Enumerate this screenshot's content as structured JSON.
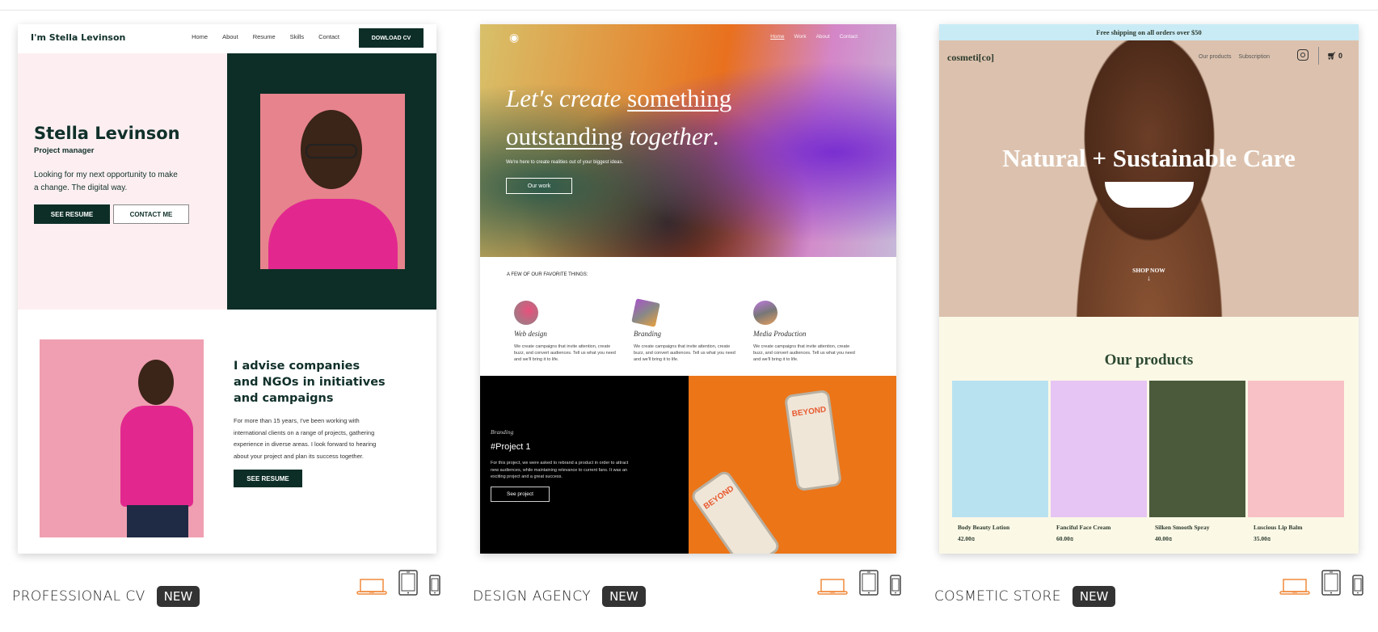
{
  "templates": [
    {
      "name": "PROFESSIONAL CV",
      "badge": "NEW",
      "preview": {
        "nav": {
          "logo": "I'm Stella Levinson",
          "links": [
            "Home",
            "About",
            "Resume",
            "Skills",
            "Contact"
          ],
          "cta": "DOWLOAD CV"
        },
        "hero": {
          "name": "Stella Levinson",
          "role": "Project manager",
          "tagline": "Looking for my next opportunity to make a change. The digital way.",
          "primary_button": "SEE RESUME",
          "secondary_button": "CONTACT ME"
        },
        "about": {
          "heading": "I advise companies and NGOs in initiatives and campaigns",
          "body": "For more than 15 years, I've been working with international clients on a range of projects, gathering experience in diverse areas. I look forward to hearing about your project and plan its success together.",
          "button": "SEE RESUME"
        }
      }
    },
    {
      "name": "DESIGN AGENCY",
      "badge": "NEW",
      "preview": {
        "nav": {
          "links": [
            "Home",
            "Work",
            "About",
            "Contact"
          ]
        },
        "hero": {
          "line1_plain": "Let's create ",
          "line1_underlined": "something",
          "line2_underlined": "outstanding",
          "line2_plain": " together",
          "line2_end": ".",
          "subtitle": "We're here to create realities out of your biggest ideas.",
          "button": "Our work"
        },
        "favorites": {
          "heading": "A FEW OF OUR FAVORITE THINGS:",
          "services": [
            {
              "title": "Web design",
              "text": "We create campaigns that invite attention, create buzz, and convert audiences. Tell us what you need and we'll bring it to life."
            },
            {
              "title": "Branding",
              "text": "We create campaigns that invite attention, create buzz, and convert audiences. Tell us what you need and we'll bring it to life."
            },
            {
              "title": "Media Production",
              "text": "We create campaigns that invite attention, create buzz, and convert audiences. Tell us what you need and we'll bring it to life."
            }
          ]
        },
        "project": {
          "category": "Branding",
          "title": "#Project 1",
          "text": "For this project, we were asked to rebrand a product in order to attract new audiences, while maintaining relevance to current fans. It was an exciting project and a great success.",
          "button": "See project",
          "can_text": "BEYOND"
        }
      }
    },
    {
      "name": "COSMETIC STORE",
      "badge": "NEW",
      "preview": {
        "shipping_bar": "Free shipping on all orders over $50",
        "nav": {
          "logo": "cosmeti[co]",
          "links": [
            "Our products",
            "Subscription"
          ],
          "cart_count": "0"
        },
        "hero": {
          "title": "Natural + Sustainable Care",
          "cta": "SHOP NOW"
        },
        "products_heading": "Our products",
        "products": [
          {
            "name": "Body Beauty Lotion",
            "price": "42.00₪",
            "bg": "#b9e2f1"
          },
          {
            "name": "Fanciful Face Cream",
            "price": "60.00₪",
            "bg": "#e6c4f3"
          },
          {
            "name": "Silken Smooth Spray",
            "price": "40.00₪",
            "bg": "#4a5a3a"
          },
          {
            "name": "Luscious Lip Balm",
            "price": "35.00₪",
            "bg": "#f7c1c5"
          }
        ]
      }
    }
  ],
  "device_icons": [
    "laptop-icon",
    "tablet-icon",
    "phone-icon"
  ],
  "colors": {
    "active_device": "#f08a3c",
    "inactive_device": "#444444",
    "badge_bg": "#333333",
    "cv_dark_green": "#0d2e27",
    "cv_pink": "#fdeff1"
  }
}
